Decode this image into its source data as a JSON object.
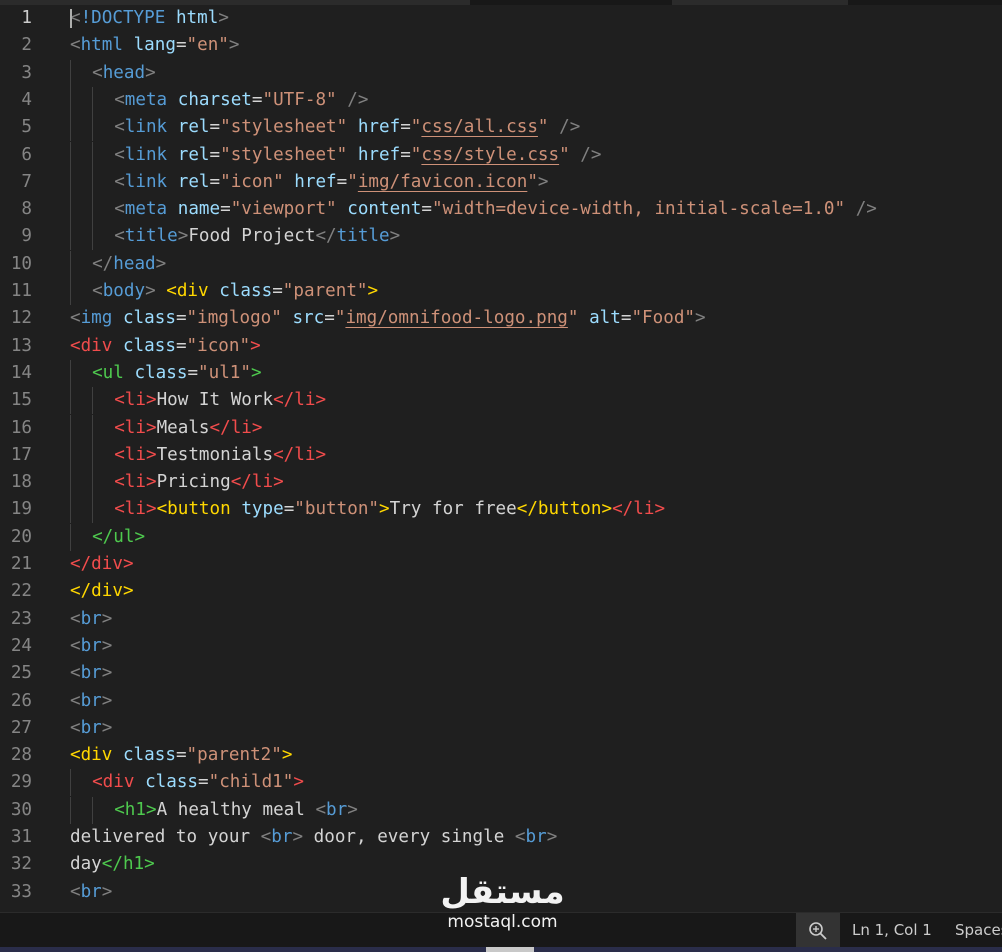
{
  "editor": {
    "active_line": 1,
    "lines": [
      {
        "n": "1",
        "indent": 0,
        "tokens": [
          [
            "punc",
            "<"
          ],
          [
            "doctype",
            "!DOCTYPE"
          ],
          [
            "text",
            " "
          ],
          [
            "attr",
            "html"
          ],
          [
            "punc",
            ">"
          ]
        ]
      },
      {
        "n": "2",
        "indent": 0,
        "tokens": [
          [
            "punc",
            "<"
          ],
          [
            "tag",
            "html"
          ],
          [
            "text",
            " "
          ],
          [
            "attr",
            "lang"
          ],
          [
            "text",
            "="
          ],
          [
            "str",
            "\"en\""
          ],
          [
            "punc",
            ">"
          ]
        ]
      },
      {
        "n": "3",
        "indent": 1,
        "tokens": [
          [
            "punc",
            "<"
          ],
          [
            "tag",
            "head"
          ],
          [
            "punc",
            ">"
          ]
        ]
      },
      {
        "n": "4",
        "indent": 2,
        "tokens": [
          [
            "punc",
            "<"
          ],
          [
            "tag",
            "meta"
          ],
          [
            "text",
            " "
          ],
          [
            "attr",
            "charset"
          ],
          [
            "text",
            "="
          ],
          [
            "str",
            "\"UTF-8\""
          ],
          [
            "text",
            " "
          ],
          [
            "punc",
            "/>"
          ]
        ]
      },
      {
        "n": "5",
        "indent": 2,
        "tokens": [
          [
            "punc",
            "<"
          ],
          [
            "tag",
            "link"
          ],
          [
            "text",
            " "
          ],
          [
            "attr",
            "rel"
          ],
          [
            "text",
            "="
          ],
          [
            "str",
            "\"stylesheet\""
          ],
          [
            "text",
            " "
          ],
          [
            "attr",
            "href"
          ],
          [
            "text",
            "="
          ],
          [
            "str",
            "\""
          ],
          [
            "link",
            "css/all.css"
          ],
          [
            "str",
            "\""
          ],
          [
            "text",
            " "
          ],
          [
            "punc",
            "/>"
          ]
        ]
      },
      {
        "n": "6",
        "indent": 2,
        "tokens": [
          [
            "punc",
            "<"
          ],
          [
            "tag",
            "link"
          ],
          [
            "text",
            " "
          ],
          [
            "attr",
            "rel"
          ],
          [
            "text",
            "="
          ],
          [
            "str",
            "\"stylesheet\""
          ],
          [
            "text",
            " "
          ],
          [
            "attr",
            "href"
          ],
          [
            "text",
            "="
          ],
          [
            "str",
            "\""
          ],
          [
            "link",
            "css/style.css"
          ],
          [
            "str",
            "\""
          ],
          [
            "text",
            " "
          ],
          [
            "punc",
            "/>"
          ]
        ]
      },
      {
        "n": "7",
        "indent": 2,
        "tokens": [
          [
            "punc",
            "<"
          ],
          [
            "tag",
            "link"
          ],
          [
            "text",
            " "
          ],
          [
            "attr",
            "rel"
          ],
          [
            "text",
            "="
          ],
          [
            "str",
            "\"icon\""
          ],
          [
            "text",
            " "
          ],
          [
            "attr",
            "href"
          ],
          [
            "text",
            "="
          ],
          [
            "str",
            "\""
          ],
          [
            "link",
            "img/favicon.icon"
          ],
          [
            "str",
            "\""
          ],
          [
            "punc",
            ">"
          ]
        ]
      },
      {
        "n": "8",
        "indent": 2,
        "tokens": [
          [
            "punc",
            "<"
          ],
          [
            "tag",
            "meta"
          ],
          [
            "text",
            " "
          ],
          [
            "attr",
            "name"
          ],
          [
            "text",
            "="
          ],
          [
            "str",
            "\"viewport\""
          ],
          [
            "text",
            " "
          ],
          [
            "attr",
            "content"
          ],
          [
            "text",
            "="
          ],
          [
            "str",
            "\"width=device-width, initial-scale=1.0\""
          ],
          [
            "text",
            " "
          ],
          [
            "punc",
            "/>"
          ]
        ]
      },
      {
        "n": "9",
        "indent": 2,
        "tokens": [
          [
            "punc",
            "<"
          ],
          [
            "tag",
            "title"
          ],
          [
            "punc",
            ">"
          ],
          [
            "text",
            "Food Project"
          ],
          [
            "punc",
            "</"
          ],
          [
            "tag",
            "title"
          ],
          [
            "punc",
            ">"
          ]
        ]
      },
      {
        "n": "10",
        "indent": 1,
        "tokens": [
          [
            "punc",
            "</"
          ],
          [
            "tag",
            "head"
          ],
          [
            "punc",
            ">"
          ]
        ]
      },
      {
        "n": "11",
        "indent": 1,
        "tokens": [
          [
            "punc",
            "<"
          ],
          [
            "tag",
            "body"
          ],
          [
            "punc",
            ">"
          ],
          [
            "text",
            " "
          ],
          [
            "yellow",
            "<div"
          ],
          [
            "text",
            " "
          ],
          [
            "attr",
            "class"
          ],
          [
            "text",
            "="
          ],
          [
            "str",
            "\"parent\""
          ],
          [
            "yellow",
            ">"
          ]
        ]
      },
      {
        "n": "12",
        "indent": 0,
        "tokens": [
          [
            "punc",
            "<"
          ],
          [
            "tag",
            "img"
          ],
          [
            "text",
            " "
          ],
          [
            "attr",
            "class"
          ],
          [
            "text",
            "="
          ],
          [
            "str",
            "\"imglogo\""
          ],
          [
            "text",
            " "
          ],
          [
            "attr",
            "src"
          ],
          [
            "text",
            "="
          ],
          [
            "str",
            "\""
          ],
          [
            "link",
            "img/omnifood-logo.png"
          ],
          [
            "str",
            "\""
          ],
          [
            "text",
            " "
          ],
          [
            "attr",
            "alt"
          ],
          [
            "text",
            "="
          ],
          [
            "str",
            "\"Food\""
          ],
          [
            "punc",
            ">"
          ]
        ]
      },
      {
        "n": "13",
        "indent": 0,
        "tokens": [
          [
            "red",
            "<div"
          ],
          [
            "text",
            " "
          ],
          [
            "attr",
            "class"
          ],
          [
            "text",
            "="
          ],
          [
            "str",
            "\"icon\""
          ],
          [
            "red",
            ">"
          ]
        ]
      },
      {
        "n": "14",
        "indent": 1,
        "tokens": [
          [
            "green",
            "<ul"
          ],
          [
            "text",
            " "
          ],
          [
            "attr",
            "class"
          ],
          [
            "text",
            "="
          ],
          [
            "str",
            "\"ul1\""
          ],
          [
            "green",
            ">"
          ]
        ]
      },
      {
        "n": "15",
        "indent": 2,
        "tokens": [
          [
            "red",
            "<li>"
          ],
          [
            "text",
            "How It Work"
          ],
          [
            "red",
            "</li>"
          ]
        ]
      },
      {
        "n": "16",
        "indent": 2,
        "tokens": [
          [
            "red",
            "<li>"
          ],
          [
            "text",
            "Meals"
          ],
          [
            "red",
            "</li>"
          ]
        ]
      },
      {
        "n": "17",
        "indent": 2,
        "tokens": [
          [
            "red",
            "<li>"
          ],
          [
            "text",
            "Testmonials"
          ],
          [
            "red",
            "</li>"
          ]
        ]
      },
      {
        "n": "18",
        "indent": 2,
        "tokens": [
          [
            "red",
            "<li>"
          ],
          [
            "text",
            "Pricing"
          ],
          [
            "red",
            "</li>"
          ]
        ]
      },
      {
        "n": "19",
        "indent": 2,
        "tokens": [
          [
            "red",
            "<li>"
          ],
          [
            "yellow",
            "<button"
          ],
          [
            "text",
            " "
          ],
          [
            "attr",
            "type"
          ],
          [
            "text",
            "="
          ],
          [
            "str",
            "\"button\""
          ],
          [
            "yellow",
            ">"
          ],
          [
            "text",
            "Try for free"
          ],
          [
            "yellow",
            "</button>"
          ],
          [
            "red",
            "</li>"
          ]
        ]
      },
      {
        "n": "20",
        "indent": 1,
        "tokens": [
          [
            "green",
            "</ul>"
          ]
        ]
      },
      {
        "n": "21",
        "indent": 0,
        "tokens": [
          [
            "red",
            "</div>"
          ]
        ]
      },
      {
        "n": "22",
        "indent": 0,
        "tokens": [
          [
            "yellow",
            "</div>"
          ]
        ]
      },
      {
        "n": "23",
        "indent": 0,
        "tokens": [
          [
            "punc",
            "<"
          ],
          [
            "tag",
            "br"
          ],
          [
            "punc",
            ">"
          ]
        ]
      },
      {
        "n": "24",
        "indent": 0,
        "tokens": [
          [
            "punc",
            "<"
          ],
          [
            "tag",
            "br"
          ],
          [
            "punc",
            ">"
          ]
        ]
      },
      {
        "n": "25",
        "indent": 0,
        "tokens": [
          [
            "punc",
            "<"
          ],
          [
            "tag",
            "br"
          ],
          [
            "punc",
            ">"
          ]
        ]
      },
      {
        "n": "26",
        "indent": 0,
        "tokens": [
          [
            "punc",
            "<"
          ],
          [
            "tag",
            "br"
          ],
          [
            "punc",
            ">"
          ]
        ]
      },
      {
        "n": "27",
        "indent": 0,
        "tokens": [
          [
            "punc",
            "<"
          ],
          [
            "tag",
            "br"
          ],
          [
            "punc",
            ">"
          ]
        ]
      },
      {
        "n": "28",
        "indent": 0,
        "tokens": [
          [
            "yellow",
            "<div"
          ],
          [
            "text",
            " "
          ],
          [
            "attr",
            "class"
          ],
          [
            "text",
            "="
          ],
          [
            "str",
            "\"parent2\""
          ],
          [
            "yellow",
            ">"
          ]
        ]
      },
      {
        "n": "29",
        "indent": 1,
        "tokens": [
          [
            "red",
            "<div"
          ],
          [
            "text",
            " "
          ],
          [
            "attr",
            "class"
          ],
          [
            "text",
            "="
          ],
          [
            "str",
            "\"child1\""
          ],
          [
            "red",
            ">"
          ]
        ]
      },
      {
        "n": "30",
        "indent": 2,
        "tokens": [
          [
            "green",
            "<h1>"
          ],
          [
            "text",
            "A healthy meal "
          ],
          [
            "punc",
            "<"
          ],
          [
            "tag",
            "br"
          ],
          [
            "punc",
            ">"
          ]
        ]
      },
      {
        "n": "31",
        "indent": 0,
        "tokens": [
          [
            "text",
            "delivered to your "
          ],
          [
            "punc",
            "<"
          ],
          [
            "tag",
            "br"
          ],
          [
            "punc",
            ">"
          ],
          [
            "text",
            " door, every single "
          ],
          [
            "punc",
            "<"
          ],
          [
            "tag",
            "br"
          ],
          [
            "punc",
            ">"
          ]
        ]
      },
      {
        "n": "32",
        "indent": 0,
        "tokens": [
          [
            "text",
            "day"
          ],
          [
            "green",
            "</h1>"
          ]
        ]
      },
      {
        "n": "33",
        "indent": 0,
        "tokens": [
          [
            "punc",
            "<"
          ],
          [
            "tag",
            "br"
          ],
          [
            "punc",
            ">"
          ]
        ]
      }
    ]
  },
  "statusbar": {
    "zoom_icon": "zoom-in-icon",
    "position": "Ln 1, Col 1",
    "spaces": "Spaces"
  },
  "watermark": {
    "arabic": "مستقل",
    "latin": "mostaql.com"
  }
}
